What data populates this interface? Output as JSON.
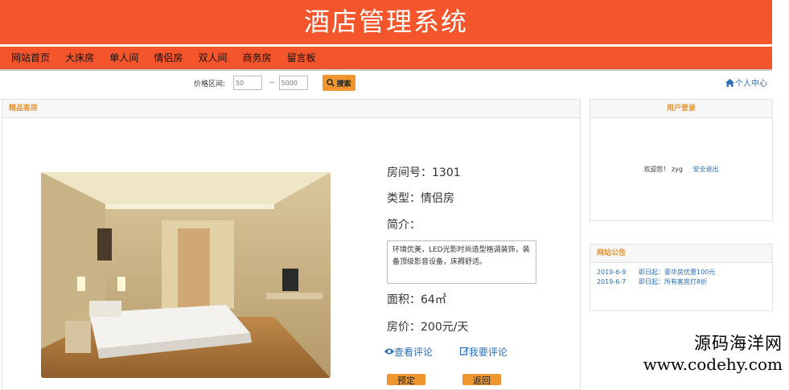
{
  "header": {
    "title": "酒店管理系统"
  },
  "nav": {
    "items": [
      "网站首页",
      "大床房",
      "单人间",
      "情侣房",
      "双人间",
      "商务房",
      "留言板"
    ]
  },
  "search": {
    "label": "价格区间:",
    "min_value": "50",
    "separator": "--",
    "max_value": "5000",
    "button_label": "搜索"
  },
  "user_center": {
    "label": "个人中心"
  },
  "main_panel": {
    "title": "精品客房",
    "room_number_label": "房间号：",
    "room_number": "1301",
    "type_label": "类型：",
    "type": "情侣房",
    "intro_label": "简介：",
    "intro": "环境优美，LED光影时尚造型格调装饰，装备顶级影音设备，床褥舒适。",
    "area_label": "面积：",
    "area": "64㎡",
    "price_label": "房价：",
    "price": "200元/天",
    "view_comments": "查看评论",
    "write_comment": "我要评论",
    "book_button": "预定",
    "back_button": "返回"
  },
  "login_panel": {
    "title": "用户登录",
    "welcome": "欢迎您！",
    "username": "zyg",
    "logout": "安全退出"
  },
  "news_panel": {
    "title": "网站公告",
    "items": [
      {
        "date": "2019-6-9",
        "text": "即日起：豪华房优惠100元"
      },
      {
        "date": "2019-6-7",
        "text": "即日起：所有客房打8折"
      }
    ]
  },
  "watermark": {
    "line1": "源码海洋网",
    "line2": "www.codehy.com"
  },
  "colors": {
    "brand": "#f4552a",
    "accent": "#f0962e",
    "link": "#2a6fb8"
  }
}
